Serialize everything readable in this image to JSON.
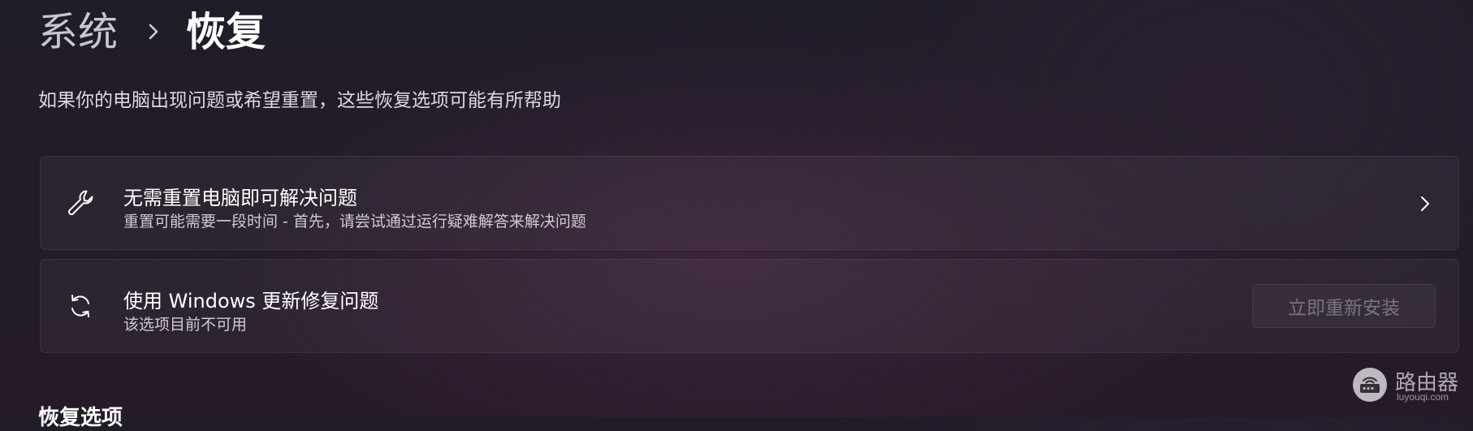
{
  "breadcrumb": {
    "parent": "系统",
    "separator": "›",
    "current": "恢复"
  },
  "subtitle": "如果你的电脑出现问题或希望重置，这些恢复选项可能有所帮助",
  "cards": [
    {
      "icon": "wrench-icon",
      "title": "无需重置电脑即可解决问题",
      "description": "重置可能需要一段时间 - 首先，请尝试通过运行疑难解答来解决问题",
      "action": "chevron-right-icon"
    },
    {
      "icon": "sync-icon",
      "title": "使用 Windows 更新修复问题",
      "description": "该选项目前不可用",
      "button_label": "立即重新安装",
      "button_state": "disabled"
    }
  ],
  "section_heading": "恢复选项",
  "watermark": {
    "logo": "router-logo",
    "name": "路由器",
    "url": "luyouqi.com"
  },
  "colors": {
    "background": "#221c28",
    "card": "#2e2833",
    "text_primary": "#ffffff",
    "text_secondary": "#cfcbd2",
    "button_disabled_text": "#7a7580"
  }
}
